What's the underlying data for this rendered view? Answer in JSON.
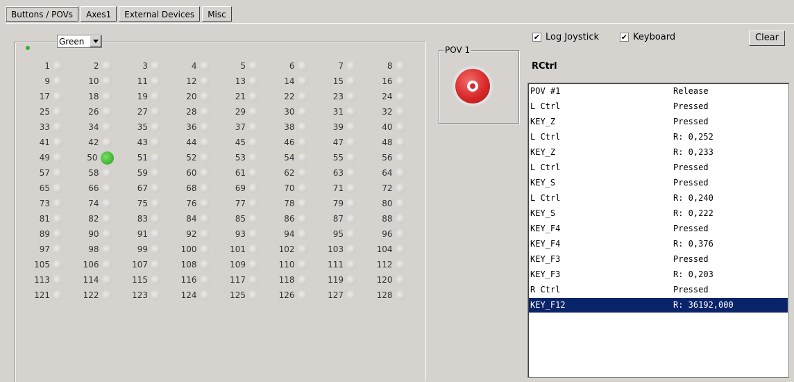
{
  "tabs": [
    "Buttons / POVs",
    "Axes1",
    "External Devices",
    "Misc"
  ],
  "color_select": {
    "value": "Green"
  },
  "buttons": {
    "pressed": [
      50
    ],
    "numbers": [
      1,
      2,
      3,
      4,
      5,
      6,
      7,
      8,
      9,
      10,
      11,
      12,
      13,
      14,
      15,
      16,
      17,
      18,
      19,
      20,
      21,
      22,
      23,
      24,
      25,
      26,
      27,
      28,
      29,
      30,
      31,
      32,
      33,
      34,
      35,
      36,
      37,
      38,
      39,
      40,
      41,
      42,
      43,
      44,
      45,
      46,
      47,
      48,
      49,
      50,
      51,
      52,
      53,
      54,
      55,
      56,
      57,
      58,
      59,
      60,
      61,
      62,
      63,
      64,
      65,
      66,
      67,
      68,
      69,
      70,
      71,
      72,
      73,
      74,
      75,
      76,
      77,
      78,
      79,
      80,
      81,
      82,
      83,
      84,
      85,
      86,
      87,
      88,
      89,
      90,
      91,
      92,
      93,
      94,
      95,
      96,
      97,
      98,
      99,
      100,
      101,
      102,
      103,
      104,
      105,
      106,
      107,
      108,
      109,
      110,
      111,
      112,
      113,
      114,
      115,
      116,
      117,
      118,
      119,
      120,
      121,
      122,
      123,
      124,
      125,
      126,
      127,
      128
    ]
  },
  "pov": {
    "label": "POV 1"
  },
  "options": {
    "log_joystick": {
      "label": "Log Joystick",
      "checked": true
    },
    "keyboard": {
      "label": "Keyboard",
      "checked": true
    },
    "clear_label": "Clear"
  },
  "current_key": "RCtrl",
  "log": [
    {
      "key": "POV #1",
      "state": "Release"
    },
    {
      "key": "L Ctrl",
      "state": "Pressed"
    },
    {
      "key": "KEY_Z",
      "state": "Pressed"
    },
    {
      "key": "L Ctrl",
      "state": "R: 0,252"
    },
    {
      "key": "KEY_Z",
      "state": "R: 0,233"
    },
    {
      "key": "L Ctrl",
      "state": "Pressed"
    },
    {
      "key": "KEY_S",
      "state": "Pressed"
    },
    {
      "key": "L Ctrl",
      "state": "R: 0,240"
    },
    {
      "key": "KEY_S",
      "state": "R: 0,222"
    },
    {
      "key": "KEY_F4",
      "state": "Pressed"
    },
    {
      "key": "KEY_F4",
      "state": "R: 0,376"
    },
    {
      "key": "KEY_F3",
      "state": "Pressed"
    },
    {
      "key": "KEY_F3",
      "state": "R: 0,203"
    },
    {
      "key": "R Ctrl",
      "state": "Pressed"
    },
    {
      "key": "KEY_F12",
      "state": "R: 36192,000"
    }
  ],
  "selected_log_index": 14,
  "colors": {
    "led_on": "#43b93a",
    "selection": "#0a246a",
    "pov": "#d82a2a"
  }
}
